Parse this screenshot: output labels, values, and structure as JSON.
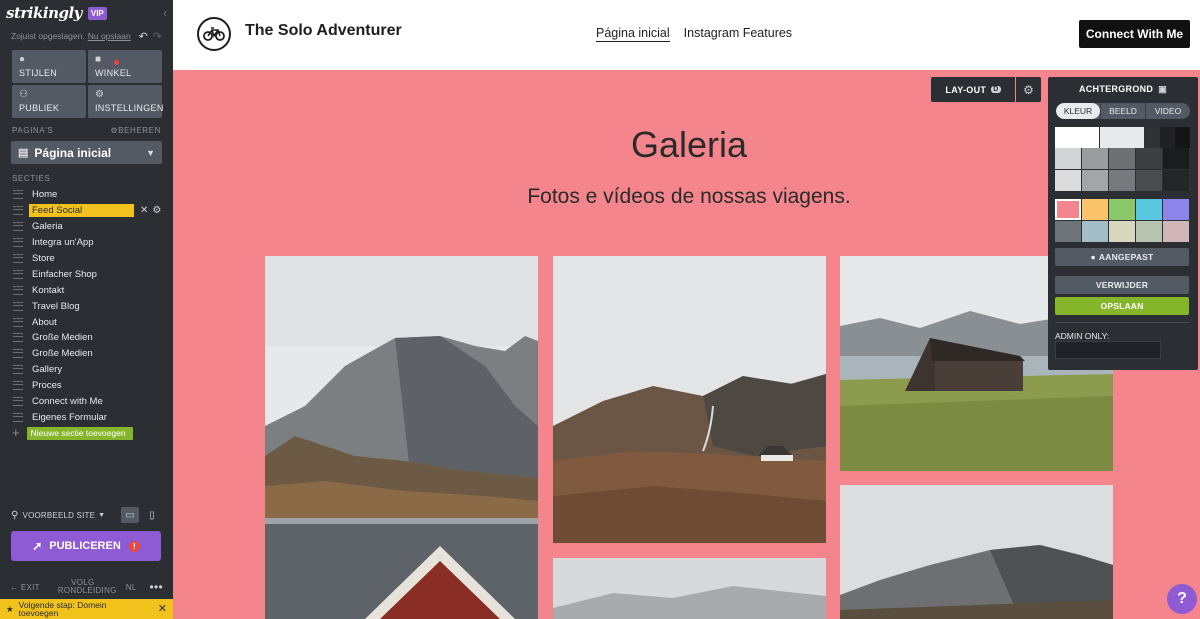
{
  "editor": {
    "logo": "strikingly",
    "vip": "VIP",
    "saved_text": "Zojuist opgeslagen.",
    "save_now": "Nu opslaan",
    "tiles": [
      {
        "label": "STIJLEN",
        "icon": "palette-icon"
      },
      {
        "label": "WINKEL",
        "icon": "bag-icon"
      },
      {
        "label": "PUBLIEK",
        "icon": "people-icon"
      },
      {
        "label": "INSTELLINGEN",
        "icon": "gear-icon"
      }
    ],
    "pages_label": "PAGINA'S",
    "manage_label": "BEHEREN",
    "current_page": "Página inicial",
    "sections_label": "SECTIES",
    "sections": [
      "Home",
      "Feed Social",
      "Galeria",
      "Integra un'App",
      "Store",
      "Einfacher Shop",
      "Kontakt",
      "Travel Blog",
      "About",
      "Große Medien",
      "Große Medien",
      "Gallery",
      "Proces",
      "Connect with Me",
      "Eigenes Formular"
    ],
    "active_section_index": 1,
    "add_section_label": "Nieuwe sectie toevoegen",
    "preview_label": "VOORBEELD SITE",
    "publish_label": "PUBLICEREN",
    "exit_label": "EXIT",
    "tour_label": "VOLG RONDLEIDING",
    "lang_label": "NL",
    "next_step": "Volgende stap: Domein toevoegen"
  },
  "site": {
    "brand": "The Solo Adventurer",
    "nav": [
      "Página inicial",
      "Instagram Features"
    ],
    "cta": "Connect With Me",
    "gallery_title": "Galeria",
    "gallery_subtitle": "Fotos e vídeos de nossas viagens.",
    "background_color": "#f4858d"
  },
  "section_tools": {
    "layout_label": "LAY-OUT",
    "layout_badge": "D"
  },
  "background_panel": {
    "title": "ACHTERGROND",
    "tabs": [
      "KLEUR",
      "BEELD",
      "VIDEO"
    ],
    "active_tab": "KLEUR",
    "custom_label": "AANGEPAST",
    "delete_label": "VERWIJDER",
    "save_label": "OPSLAAN",
    "admin_label": "ADMIN ONLY:",
    "colors": {
      "row1": [
        "#ffffff",
        "#e8e9ea",
        "#2f3135",
        "#1f2124",
        "#141517"
      ],
      "row2": [
        "#d3d4d5",
        "#9a9c9f",
        "#6e7073",
        "#3d3f42",
        "#1b1c1e"
      ],
      "row3": [
        "#dcdcdd",
        "#a3a5a8",
        "#77797c",
        "#4a4c4f",
        "#252628"
      ],
      "row4": [
        "#f4858d",
        "#fbc36b",
        "#8ac86a",
        "#59c7df",
        "#8d84e9"
      ],
      "row5": [
        "#6e7378",
        "#a3bcc7",
        "#d8d6bd",
        "#b7c4b2",
        "#d0b5b9"
      ],
      "selected": "#f4858d"
    }
  },
  "help_label": "?"
}
